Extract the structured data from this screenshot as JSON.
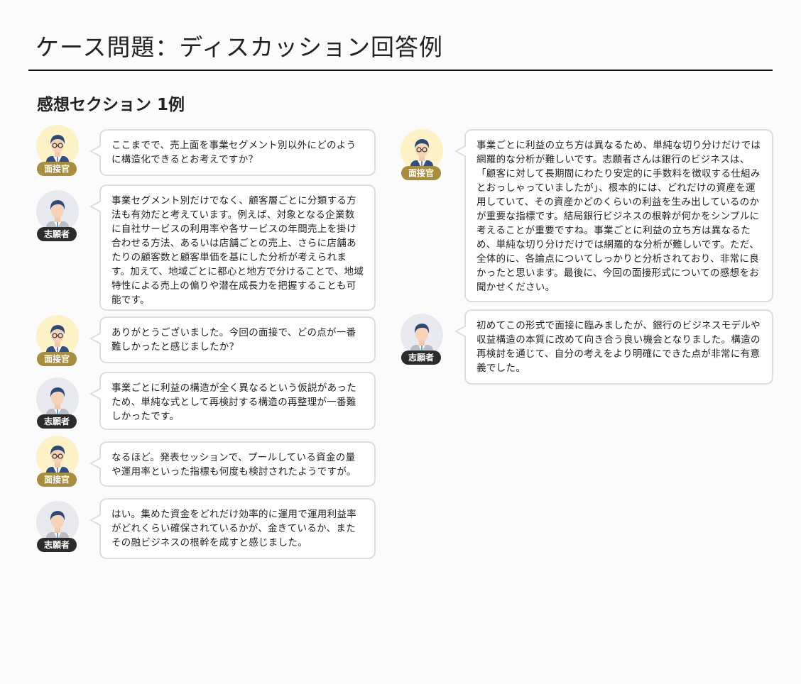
{
  "page": {
    "title": "ケース問題：ディスカッション回答例",
    "section_title": "感想セクション 1例"
  },
  "roles": {
    "interviewer": "面接官",
    "candidate": "志願者"
  },
  "messages": [
    {
      "role": "interviewer",
      "label": "面接官",
      "text": "ここまでで、売上面を事業セグメント別以外にどのように構造化できるとお考えですか？"
    },
    {
      "role": "candidate",
      "label": "志願者",
      "text": "事業セグメント別だけでなく、顧客層ごとに分類する方法も有効だと考えています。例えば、対象となる企業数に自社サービスの利用率や各サービスの年間売上を掛け合わせる方法、あるいは店舗ごとの売上、さらに店舗あたりの顧客数と顧客単価を基にした分析が考えられます。加えて、地域ごとに都心と地方で分けることで、地域特性による売上の偏りや潜在成長力を把握することも可能です。"
    },
    {
      "role": "interviewer",
      "label": "面接官",
      "text": "ありがとうございました。今回の面接で、どの点が一番難しかったと感じましたか？"
    },
    {
      "role": "candidate",
      "label": "志願者",
      "text": "事業ごとに利益の構造が全く異なるという仮説があったため、単純な式として再検討する構造の再整理が一番難しかったです。"
    },
    {
      "role": "interviewer",
      "label": "面接官",
      "text": "なるほど。発表セッションで、プールしている資金の量や運用率といった指標も何度も検討されたようですが。"
    },
    {
      "role": "candidate",
      "label": "志願者",
      "text": "はい。集めた資金をどれだけ効率的に運用で運用利益率がどれくらい確保されているかが、金きているか、またその融ビジネスの根幹を成すと感じました。"
    },
    {
      "role": "interviewer",
      "label": "面接官",
      "text": "事業ごとに利益の立ち方は異なるため、単純な切り分けだけでは網羅的な分析が難しいです。志願者さんは銀行のビジネスは、「顧客に対して長期間にわたり安定的に手数料を徴収する仕組みとおっしゃっていましたが」、根本的には、どれだけの資産を運用していて、その資産かどのくらいの利益を生み出しているのかが重要な指標です。結局銀行ビジネスの根幹が何かをシンプルに考えることが重要ですね。事業ごとに利益の立ち方は異なるため、単純な切り分けだけでは網羅的な分析が難しいです。ただ、全体的に、各論点についてしっかりと分析されており、非常に良かったと思います。最後に、今回の面接形式についての感想をお聞かせください。"
    },
    {
      "role": "candidate",
      "label": "志願者",
      "text": "初めてこの形式で面接に臨みましたが、銀行のビジネスモデルや収益構造の本質に改めて向き合う良い機会となりました。構造の再検討を通じて、自分の考えをより明確にできた点が非常に有意義でした。"
    }
  ]
}
